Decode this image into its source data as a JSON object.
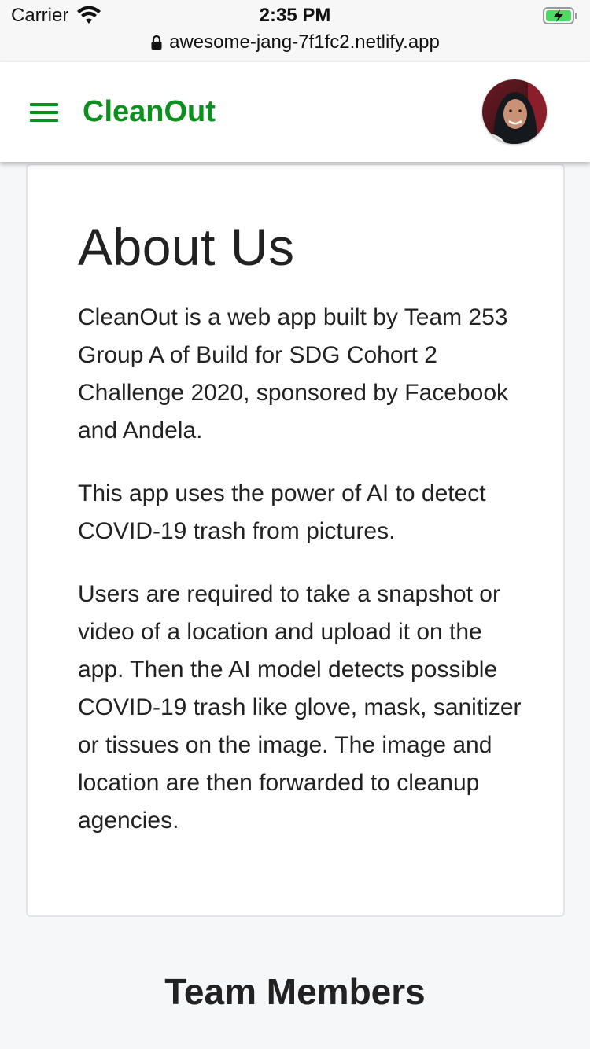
{
  "status_bar": {
    "carrier": "Carrier",
    "time": "2:35 PM",
    "url": "awesome-jang-7f1fc2.netlify.app"
  },
  "header": {
    "brand": "CleanOut",
    "brand_color": "#0b8f1f"
  },
  "about": {
    "title": "About Us",
    "paragraphs": [
      "CleanOut is a web app built by Team 253 Group A of Build for SDG Cohort 2 Challenge 2020, sponsored by Facebook and Andela.",
      "This app uses the power of AI to detect COVID-19 trash from pictures.",
      "Users are required to take a snapshot or video of a location and upload it on the app. Then the AI model detects possible COVID-19 trash like glove, mask, sanitizer or tissues on the image. The image and location are then forwarded to cleanup agencies."
    ]
  },
  "team": {
    "title": "Team Members"
  },
  "icons": {
    "menu": "hamburger-menu-icon",
    "wifi": "wifi-icon",
    "battery": "battery-charging-icon",
    "lock": "lock-icon"
  }
}
